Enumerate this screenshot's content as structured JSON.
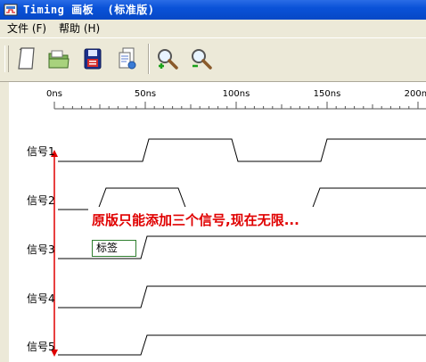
{
  "window": {
    "title": "Timing 画板  (标准版)"
  },
  "menu": {
    "items": [
      "文件 (F)",
      "帮助 (H)"
    ]
  },
  "toolbar": {
    "buttons": [
      {
        "icon": "new-document-icon"
      },
      {
        "icon": "open-folder-icon"
      },
      {
        "icon": "save-disk-icon"
      },
      {
        "icon": "save-as-icon"
      },
      {
        "icon": "zoom-in-icon"
      },
      {
        "icon": "zoom-out-icon"
      }
    ]
  },
  "ruler": {
    "labels": [
      "0ns",
      "50ns",
      "100ns",
      "150ns",
      "200ns"
    ]
  },
  "signals": [
    {
      "name": "信号1"
    },
    {
      "name": "信号2"
    },
    {
      "name": "信号3"
    },
    {
      "name": "信号4"
    },
    {
      "name": "信号5"
    }
  ],
  "note": "原版只能添加三个信号,现在无限...",
  "tag": "标签",
  "colors": {
    "title_bar": "#0a52d8",
    "note_text": "#e00000",
    "arrow": "#e00000",
    "tag_border": "#2f7f2f"
  }
}
